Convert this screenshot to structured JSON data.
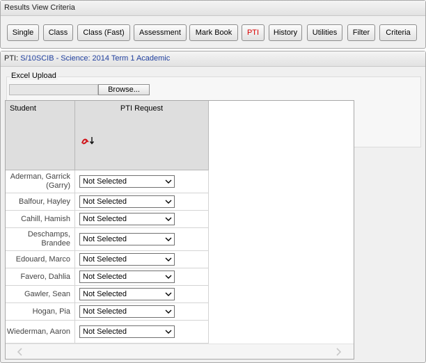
{
  "criteria_panel": {
    "title": "Results View Criteria"
  },
  "toolbar": {
    "buttons": [
      {
        "label": "Single"
      },
      {
        "label": "Class"
      },
      {
        "label": "Class (Fast)"
      },
      {
        "label": "Assessment"
      },
      {
        "label": "Mark Book"
      },
      {
        "label": "PTI",
        "active": true
      },
      {
        "label": "History"
      },
      {
        "label": "Utilities"
      },
      {
        "label": "Filter"
      },
      {
        "label": "Criteria"
      }
    ],
    "active_color": "#d90000"
  },
  "pti_panel": {
    "prefix": "PTI:",
    "class_info": "S/10SCIB - Science: 2014 Term 1 Academic",
    "link_color": "#1f3f9e"
  },
  "excel_upload": {
    "legend": "Excel Upload",
    "browse_label": "Browse..."
  },
  "grid": {
    "headers": {
      "student": "Student",
      "pti_request": "PTI Request"
    },
    "sort_icon": "sort-alpha-icon",
    "rows": [
      {
        "student": "Aderman, Garrick (Garry)",
        "pti_request": "Not Selected"
      },
      {
        "student": "Balfour, Hayley",
        "pti_request": "Not Selected"
      },
      {
        "student": "Cahill, Hamish",
        "pti_request": "Not Selected"
      },
      {
        "student": "Deschamps, Brandee",
        "pti_request": "Not Selected"
      },
      {
        "student": "Edouard, Marco",
        "pti_request": "Not Selected"
      },
      {
        "student": "Favero, Dahlia",
        "pti_request": "Not Selected"
      },
      {
        "student": "Gawler, Sean",
        "pti_request": "Not Selected"
      },
      {
        "student": "Hogan, Pia",
        "pti_request": "Not Selected"
      },
      {
        "student": "Wiederman, Aaron",
        "pti_request": "Not Selected"
      }
    ]
  }
}
